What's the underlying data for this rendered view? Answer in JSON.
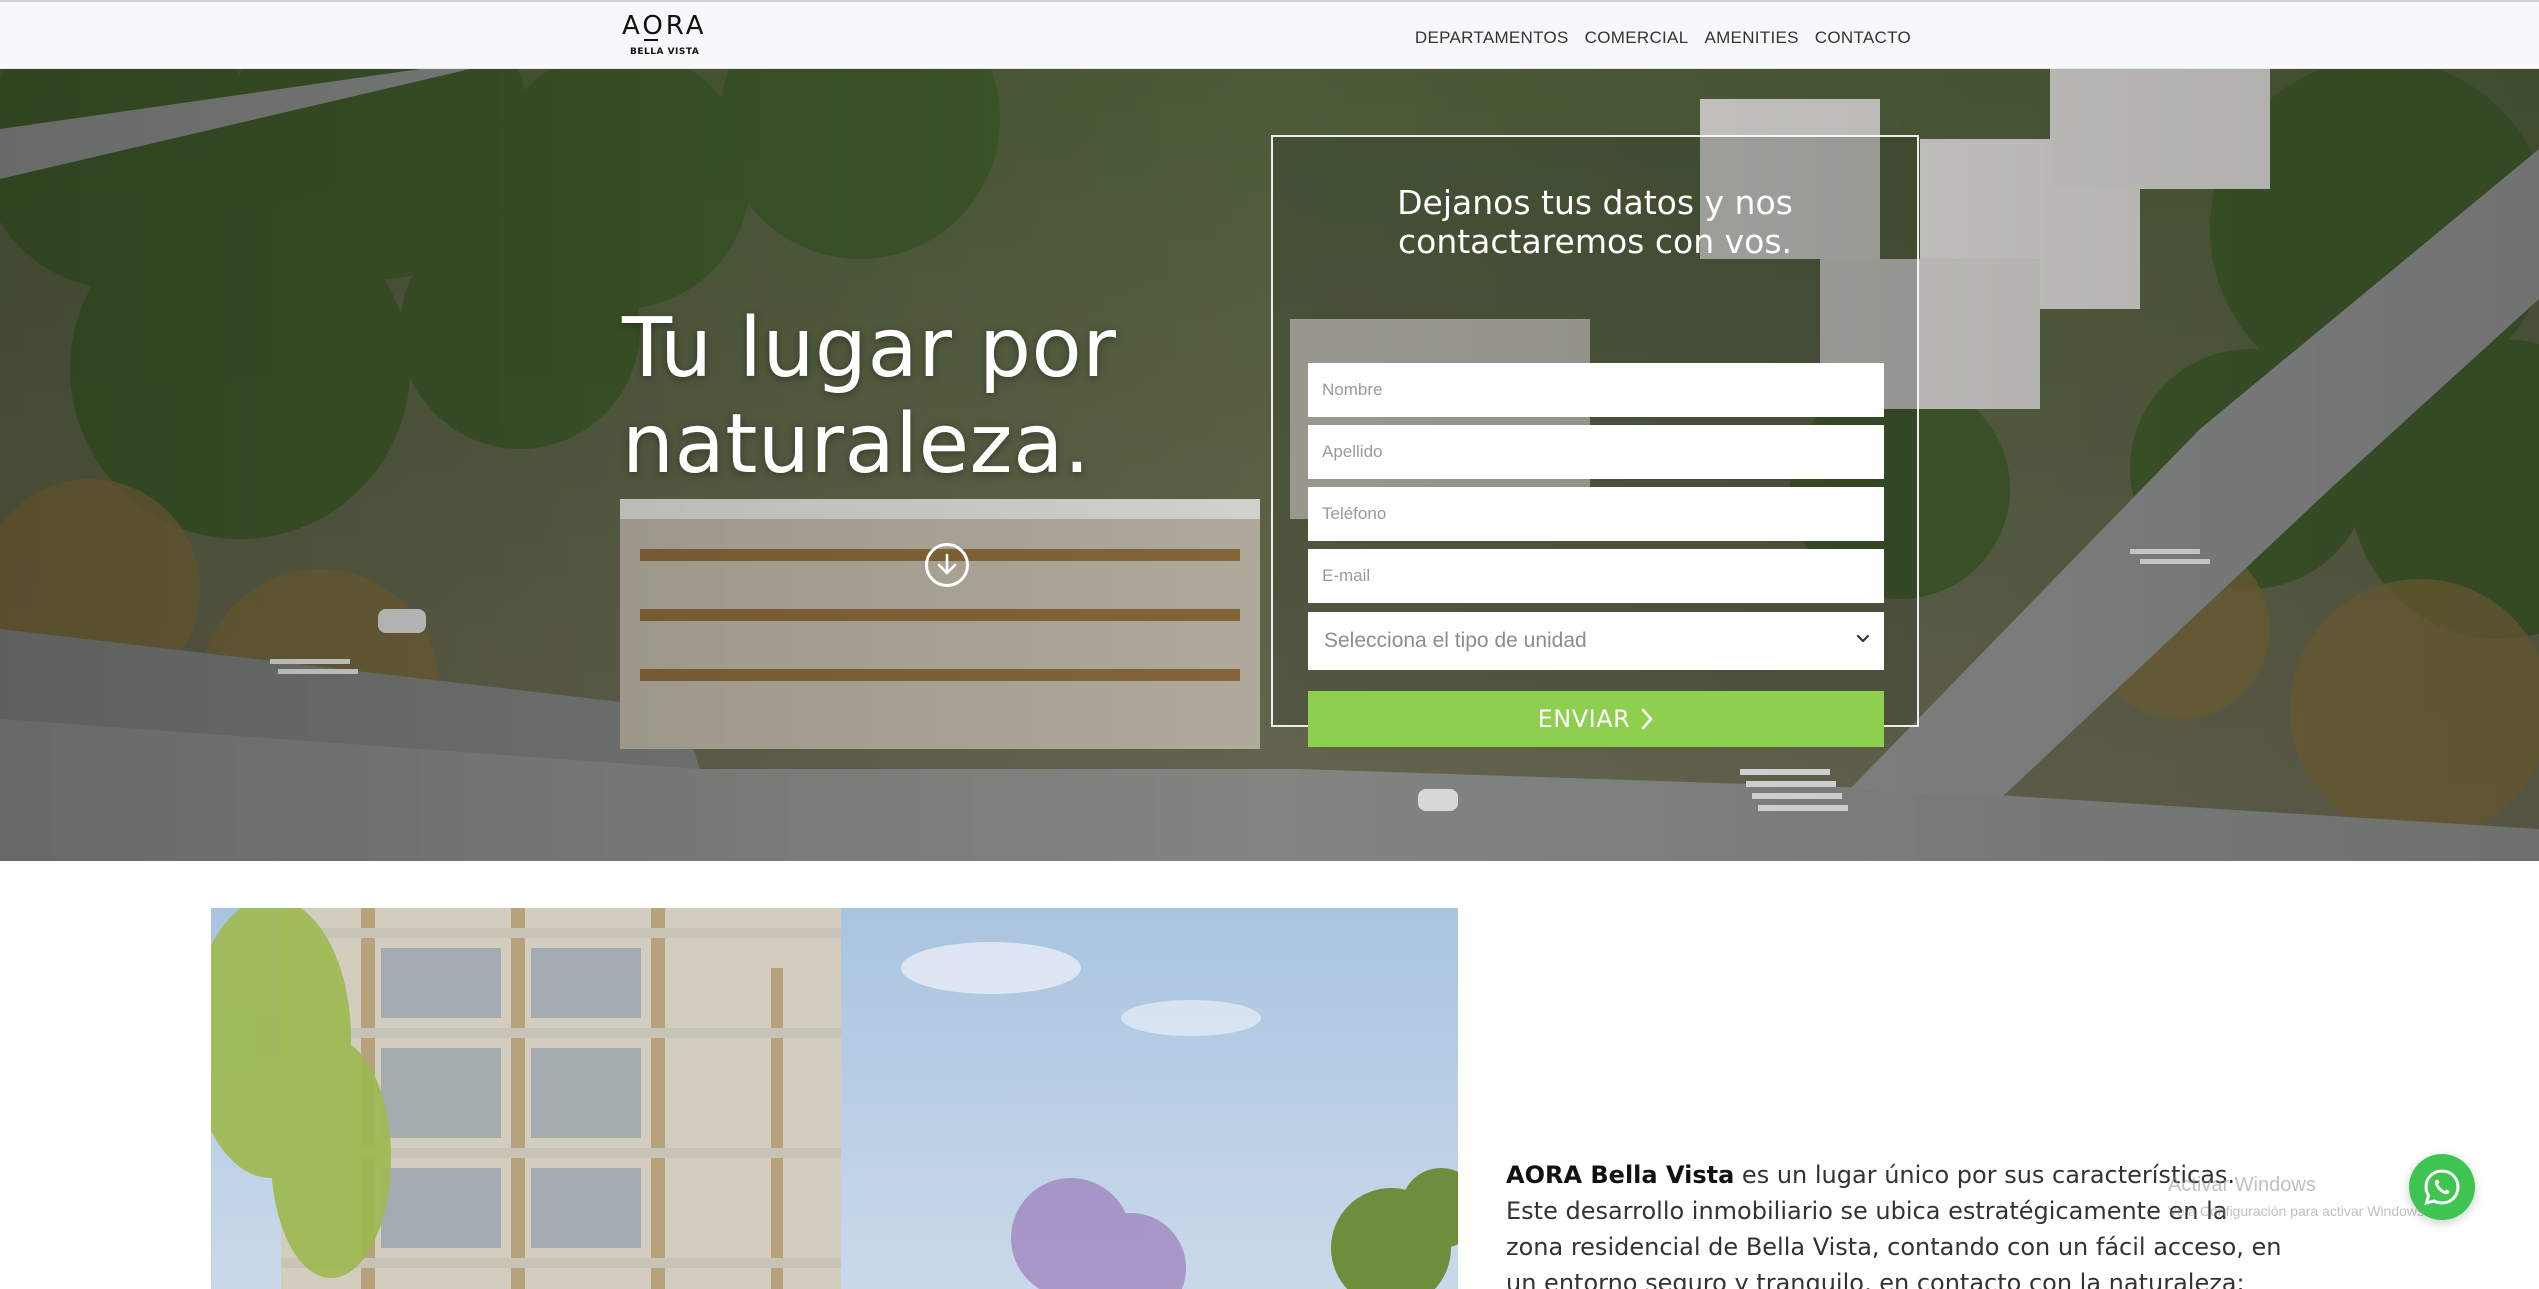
{
  "brand": {
    "logo_main": "AORA",
    "logo_sub": "BELLA VISTA"
  },
  "nav": {
    "items": [
      {
        "label": "DEPARTAMENTOS"
      },
      {
        "label": "COMERCIAL"
      },
      {
        "label": "AMENITIES"
      },
      {
        "label": "CONTACTO"
      }
    ]
  },
  "hero": {
    "title_line1": "Tu lugar por",
    "title_line2": "naturaleza."
  },
  "form": {
    "title": "Dejanos tus datos y nos contactaremos con vos.",
    "nombre_placeholder": "Nombre",
    "apellido_placeholder": "Apellido",
    "telefono_placeholder": "Teléfono",
    "email_placeholder": "E-mail",
    "unit_select_value": "Selecciona el tipo de unidad",
    "submit_label": "ENVIAR"
  },
  "about": {
    "brand_bold": "AORA Bella Vista",
    "text": " es un lugar único por sus características. Este desarrollo inmobiliario se ubica estratégicamente en la zona residencial de Bella Vista, contando con un fácil acceso, en un entorno seguro y tranquilo, en contacto con la naturaleza:"
  },
  "watermark": {
    "title": "Activar Windows",
    "subtitle": "Ve a Configuración para activar Windows."
  },
  "colors": {
    "accent_green": "#8fcf4f",
    "whatsapp_green": "#3fc451",
    "navbar_bg": "#f7f8fa"
  },
  "icons": {
    "scroll": "arrow-down-circle-icon",
    "submit": "chevron-right-icon",
    "select": "chevron-down-icon",
    "chat": "whatsapp-icon"
  }
}
